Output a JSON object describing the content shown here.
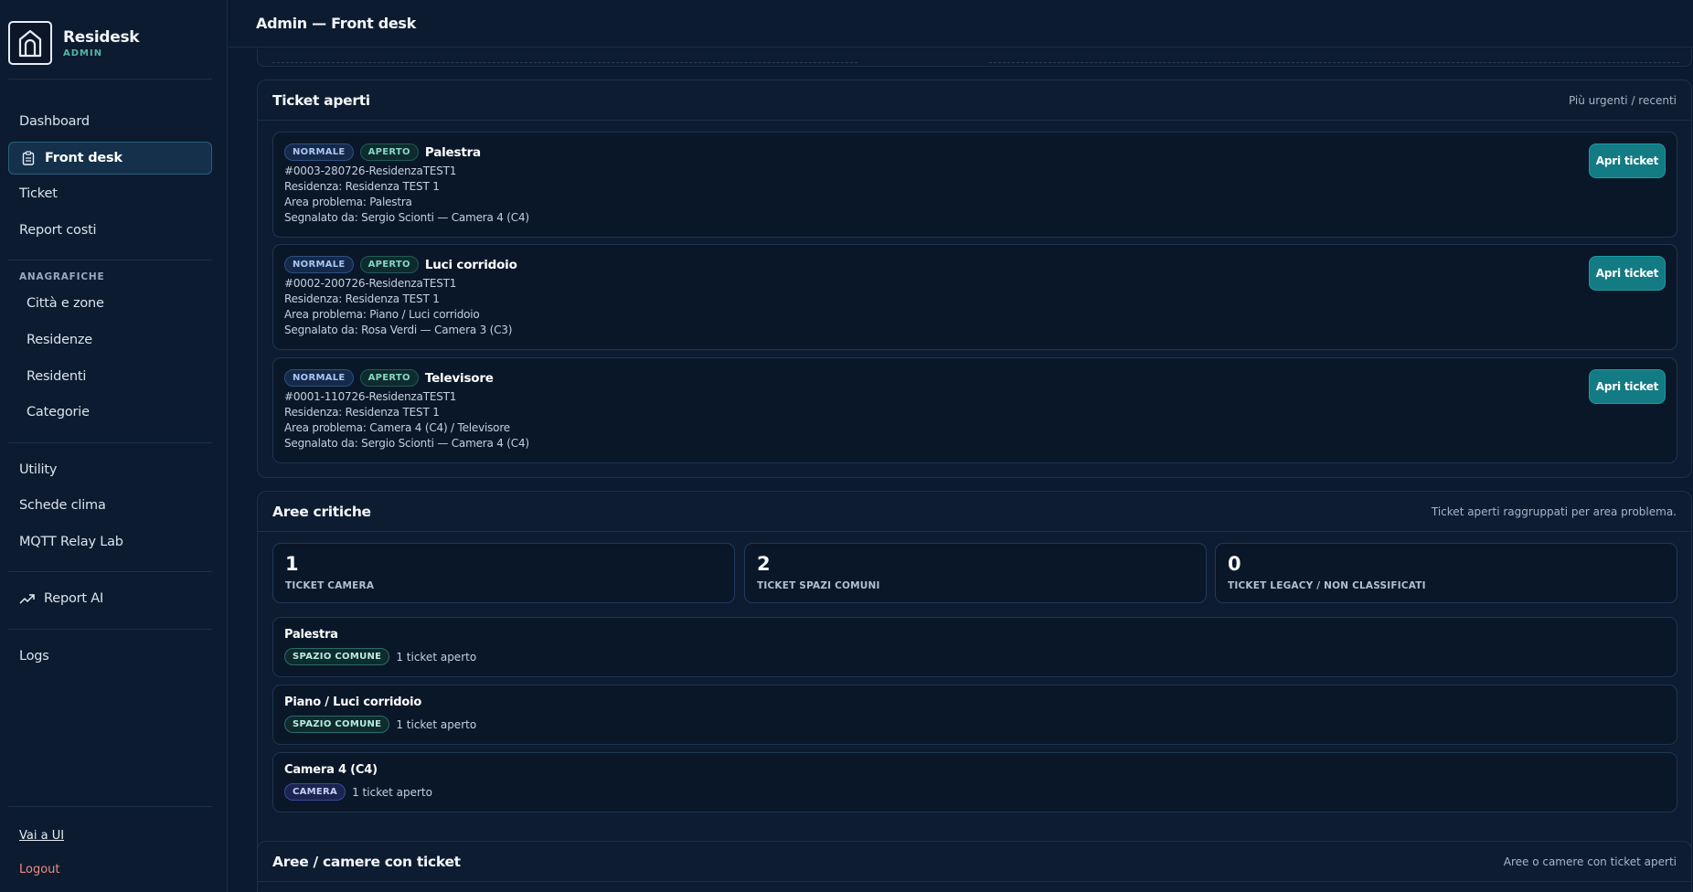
{
  "brand": {
    "name": "Residesk",
    "sub": "ADMIN"
  },
  "sidebar": {
    "nav": [
      {
        "label": "Dashboard"
      },
      {
        "label": "Front desk",
        "icon": "clipboard-icon"
      },
      {
        "label": "Ticket"
      },
      {
        "label": "Report costi"
      }
    ],
    "section_anagrafiche": "ANAGRAFICHE",
    "anagrafiche": [
      {
        "label": "Città e zone"
      },
      {
        "label": "Residenze"
      },
      {
        "label": "Residenti"
      },
      {
        "label": "Categorie"
      }
    ],
    "tools": [
      {
        "label": "Utility"
      },
      {
        "label": "Schede clima"
      },
      {
        "label": "MQTT Relay Lab"
      }
    ],
    "report_ai": {
      "label": "Report AI",
      "icon": "trend-up-icon"
    },
    "logs": {
      "label": "Logs"
    },
    "footer": {
      "ui_link": "Vai a UI",
      "logout": "Logout"
    }
  },
  "header": {
    "title": "Admin — Front desk"
  },
  "tickets_panel": {
    "title": "Ticket aperti",
    "note": "Più urgenti / recenti",
    "items": [
      {
        "priority": "NORMALE",
        "status": "APERTO",
        "title": "Palestra",
        "code": "#0003-280726-ResidenzaTEST1",
        "residenza": "Residenza: Residenza TEST 1",
        "area": "Area problema: Palestra",
        "segnalato": "Segnalato da: Sergio Scionti — Camera 4 (C4)",
        "button": "Apri ticket"
      },
      {
        "priority": "NORMALE",
        "status": "APERTO",
        "title": "Luci corridoio",
        "code": "#0002-200726-ResidenzaTEST1",
        "residenza": "Residenza: Residenza TEST 1",
        "area": "Area problema: Piano / Luci corridoio",
        "segnalato": "Segnalato da: Rosa Verdi — Camera 3 (C3)",
        "button": "Apri ticket"
      },
      {
        "priority": "NORMALE",
        "status": "APERTO",
        "title": "Televisore",
        "code": "#0001-110726-ResidenzaTEST1",
        "residenza": "Residenza: Residenza TEST 1",
        "area": "Area problema: Camera 4 (C4) / Televisore",
        "segnalato": "Segnalato da: Sergio Scionti — Camera 4 (C4)",
        "button": "Apri ticket"
      }
    ]
  },
  "critical_panel": {
    "title": "Aree critiche",
    "note": "Ticket aperti raggruppati per area problema.",
    "stats": [
      {
        "value": "1",
        "label": "TICKET CAMERA"
      },
      {
        "value": "2",
        "label": "TICKET SPAZI COMUNI"
      },
      {
        "value": "0",
        "label": "TICKET LEGACY / NON CLASSIFICATI"
      }
    ],
    "areas": [
      {
        "name": "Palestra",
        "tag": "SPAZIO COMUNE",
        "count": "1 ticket aperto"
      },
      {
        "name": "Piano / Luci corridoio",
        "tag": "SPAZIO COMUNE",
        "count": "1 ticket aperto"
      },
      {
        "name": "Camera 4 (C4)",
        "tag": "CAMERA",
        "count": "1 ticket aperto"
      }
    ]
  },
  "rooms_panel": {
    "title": "Aree / camere con ticket",
    "note": "Aree o camere con ticket aperti"
  }
}
